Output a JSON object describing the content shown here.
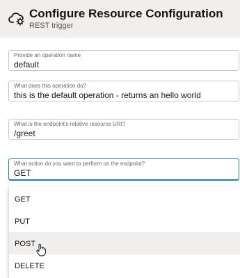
{
  "header": {
    "title": "Configure Resource Configuration",
    "subtitle": "REST trigger",
    "icon": "cloud-gear-icon"
  },
  "fields": [
    {
      "label": "Provide an operation name",
      "value": "default"
    },
    {
      "label": "What does this operation do?",
      "value": "this is the default operation - returns an hello world"
    },
    {
      "label": "What is the endpoint's relative resource URI?",
      "value": "/greet"
    },
    {
      "label": "What action do you want to perform on the endpoint?",
      "value": "GET"
    }
  ],
  "dropdown": {
    "options": [
      "GET",
      "PUT",
      "POST",
      "DELETE"
    ],
    "hovered": "POST"
  },
  "colors": {
    "accent": "#227e9e",
    "header_bg": "#f1efed"
  }
}
